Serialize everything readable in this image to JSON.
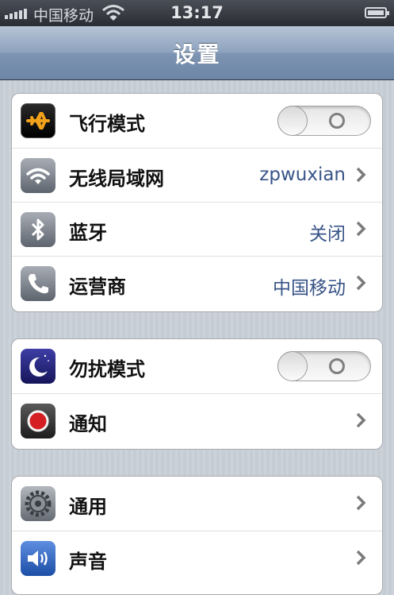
{
  "status_bar": {
    "carrier": "中国移动",
    "time": "13:17"
  },
  "nav": {
    "title": "设置"
  },
  "groups": [
    {
      "rows": [
        {
          "label": "飞行模式",
          "icon": "airplane-icon",
          "toggle": "off"
        },
        {
          "label": "无线局域网",
          "value": "zpwuxian",
          "icon": "wifi-icon"
        },
        {
          "label": "蓝牙",
          "value": "关闭",
          "icon": "bluetooth-icon"
        },
        {
          "label": "运营商",
          "value": "中国移动",
          "icon": "phone-icon"
        }
      ]
    },
    {
      "rows": [
        {
          "label": "勿扰模式",
          "icon": "moon-icon",
          "toggle": "off"
        },
        {
          "label": "通知",
          "icon": "notification-icon"
        }
      ]
    },
    {
      "rows": [
        {
          "label": "通用",
          "icon": "gear-icon"
        },
        {
          "label": "声音",
          "icon": "speaker-icon"
        }
      ]
    }
  ],
  "colors": {
    "value_text": "#385487",
    "nav_bar": "#7d94b2"
  }
}
